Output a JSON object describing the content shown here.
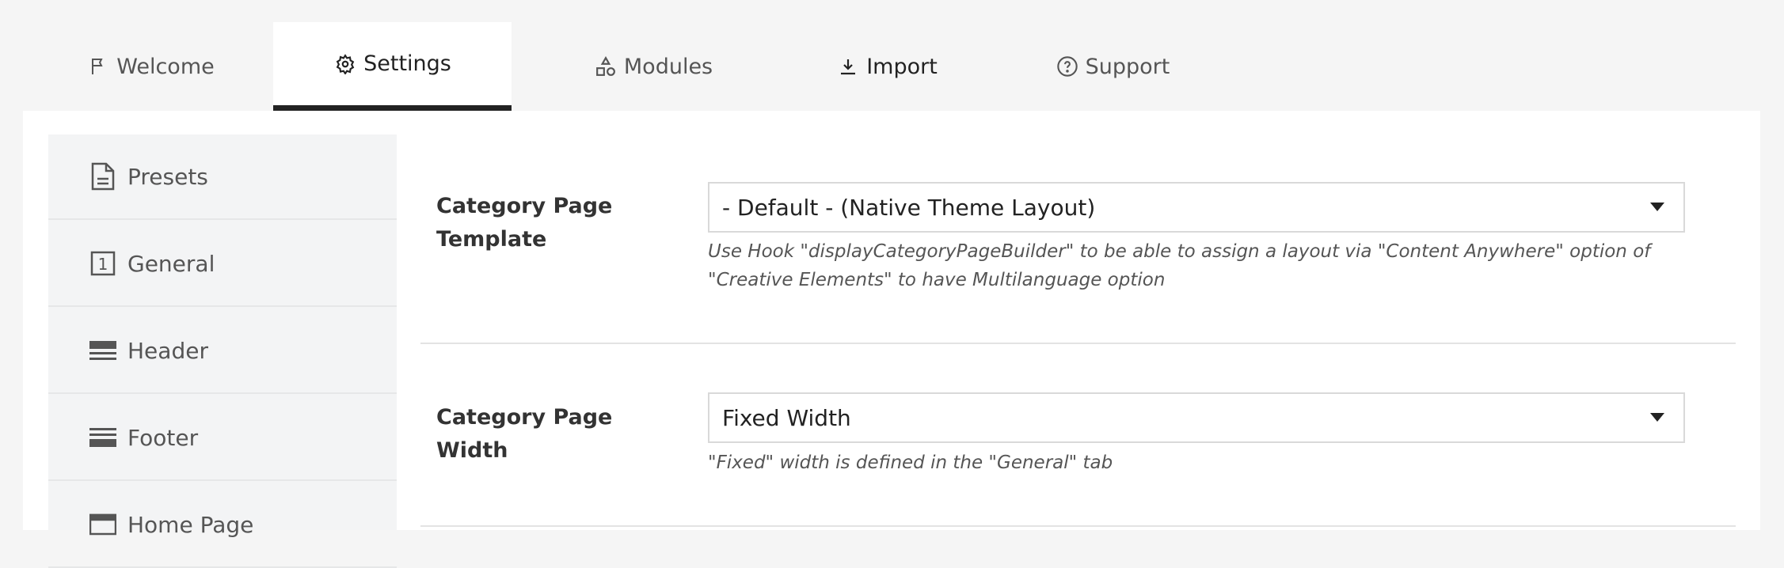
{
  "tabs": [
    {
      "label": "Welcome",
      "icon": "flag-icon"
    },
    {
      "label": "Settings",
      "icon": "gear-icon"
    },
    {
      "label": "Modules",
      "icon": "shapes-icon"
    },
    {
      "label": "Import",
      "icon": "download-icon"
    },
    {
      "label": "Support",
      "icon": "help-icon"
    }
  ],
  "sidebar": {
    "items": [
      {
        "label": "Presets",
        "icon": "document-icon"
      },
      {
        "label": "General",
        "icon": "numbered-box-icon",
        "icon_text": "1"
      },
      {
        "label": "Header",
        "icon": "header-layout-icon"
      },
      {
        "label": "Footer",
        "icon": "footer-layout-icon"
      },
      {
        "label": "Home Page",
        "icon": "page-layout-icon"
      }
    ]
  },
  "settings": {
    "category_template": {
      "label": "Category Page Template",
      "value": "- Default - (Native Theme Layout)",
      "help": "Use Hook \"displayCategoryPageBuilder\" to be able to assign a layout via \"Content Anywhere\" option of \"Creative Elements\" to have Multilanguage option"
    },
    "category_width": {
      "label": "Category Page Width",
      "value": "Fixed Width",
      "help": "\"Fixed\" width is defined in the \"General\" tab"
    }
  }
}
